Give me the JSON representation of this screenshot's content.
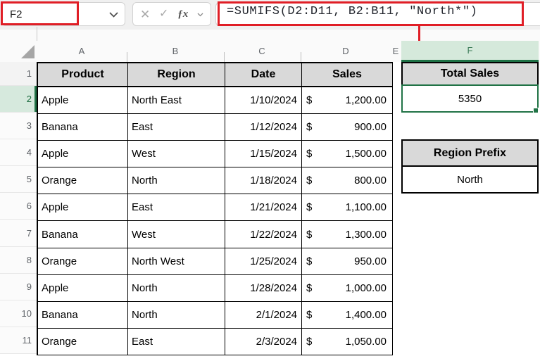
{
  "formula_bar": {
    "name_box": "F2",
    "formula": "=SUMIFS(D2:D11, B2:B11, \"North*\")",
    "cancel_icon": "✕",
    "enter_icon": "✓",
    "fx_label": "ƒx"
  },
  "grid": {
    "column_letters": [
      "A",
      "B",
      "C",
      "D",
      "E",
      "F"
    ],
    "row_numbers": [
      "1",
      "2",
      "3",
      "4",
      "5",
      "6",
      "7",
      "8",
      "9",
      "10",
      "11"
    ],
    "active_cell": "F2"
  },
  "table": {
    "headers": [
      "Product",
      "Region",
      "Date",
      "Sales"
    ],
    "rows": [
      {
        "product": "Apple",
        "region": "North East",
        "date": "1/10/2024",
        "currency": "$",
        "amount": "1,200.00"
      },
      {
        "product": "Banana",
        "region": "East",
        "date": "1/12/2024",
        "currency": "$",
        "amount": "900.00"
      },
      {
        "product": "Apple",
        "region": "West",
        "date": "1/15/2024",
        "currency": "$",
        "amount": "1,500.00"
      },
      {
        "product": "Orange",
        "region": "North",
        "date": "1/18/2024",
        "currency": "$",
        "amount": "800.00"
      },
      {
        "product": "Apple",
        "region": "East",
        "date": "1/21/2024",
        "currency": "$",
        "amount": "1,100.00"
      },
      {
        "product": "Banana",
        "region": "West",
        "date": "1/22/2024",
        "currency": "$",
        "amount": "1,300.00"
      },
      {
        "product": "Orange",
        "region": "North West",
        "date": "1/25/2024",
        "currency": "$",
        "amount": "950.00"
      },
      {
        "product": "Apple",
        "region": "North",
        "date": "1/28/2024",
        "currency": "$",
        "amount": "1,000.00"
      },
      {
        "product": "Banana",
        "region": "North",
        "date": "2/1/2024",
        "currency": "$",
        "amount": "1,400.00"
      },
      {
        "product": "Orange",
        "region": "East",
        "date": "2/3/2024",
        "currency": "$",
        "amount": "1,050.00"
      }
    ]
  },
  "summary": {
    "total_label": "Total Sales",
    "total_value": "5350",
    "prefix_label": "Region Prefix",
    "prefix_value": "North"
  },
  "colors": {
    "annotation_red": "#e01e26",
    "excel_green": "#217346",
    "selection_fill_green": "#d6e9dd",
    "table_header_fill": "#d9d9d9"
  }
}
